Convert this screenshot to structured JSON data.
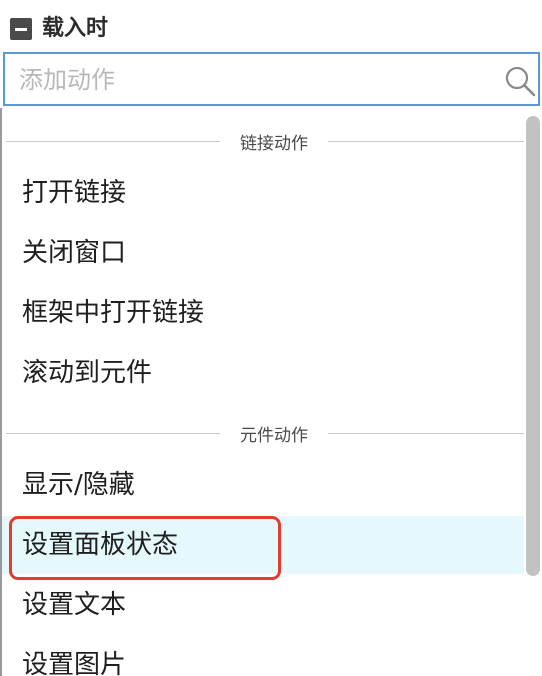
{
  "event": {
    "title": "载入时",
    "toggle_icon": "minus-square-icon"
  },
  "search": {
    "placeholder": "添加动作",
    "value": "",
    "icon": "search-icon"
  },
  "sections": [
    {
      "label": "链接动作",
      "items": [
        "打开链接",
        "关闭窗口",
        "框架中打开链接",
        "滚动到元件"
      ]
    },
    {
      "label": "元件动作",
      "items": [
        "显示/隐藏",
        "设置面板状态",
        "设置文本",
        "设置图片"
      ]
    }
  ],
  "highlighted_item": "设置面板状态",
  "colors": {
    "search_border": "#5c98d6",
    "highlight_bg": "#e5f8fc",
    "annotation_red": "#e53a2e"
  }
}
